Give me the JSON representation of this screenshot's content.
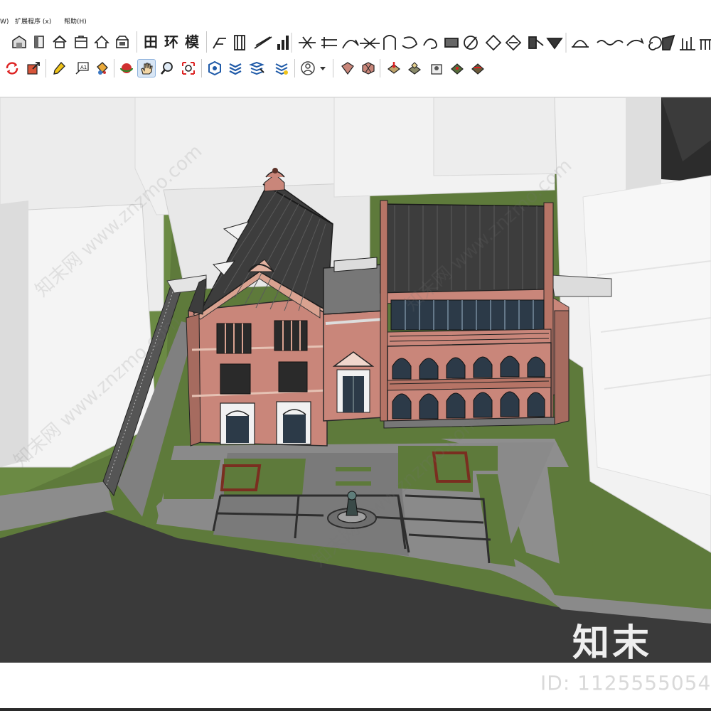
{
  "menu": {
    "items": [
      {
        "label": "W)"
      },
      {
        "label": "扩展程序 (x)"
      },
      {
        "label": "帮助(H)"
      }
    ]
  },
  "toolbar1": {
    "buttons": [
      {
        "name": "warehouse-icon"
      },
      {
        "name": "component-box-icon"
      },
      {
        "name": "house-icon"
      },
      {
        "name": "house-outline-icon"
      },
      {
        "name": "house-roof-icon"
      },
      {
        "name": "house-window-icon"
      },
      {
        "name": "grid-plan-icon",
        "glyph": "田"
      },
      {
        "name": "environment-icon",
        "glyph": "环"
      },
      {
        "name": "model-icon",
        "glyph": "模"
      }
    ]
  },
  "toolbar2": {
    "buttons": [
      {
        "name": "orbit-icon"
      },
      {
        "name": "scale-icon"
      },
      {
        "name": "paint-icon"
      },
      {
        "name": "text-tool-icon"
      },
      {
        "name": "paint-bucket-icon"
      },
      {
        "name": "orbit-sphere-icon"
      },
      {
        "name": "pan-hand-icon",
        "active": true
      },
      {
        "name": "zoom-icon"
      },
      {
        "name": "zoom-extents-icon"
      },
      {
        "name": "shapes-icon"
      },
      {
        "name": "layers-icon"
      },
      {
        "name": "stack-icon"
      },
      {
        "name": "sandbox-icon"
      },
      {
        "name": "user-account-icon"
      },
      {
        "name": "components-icon"
      },
      {
        "name": "terrain-grid-icon"
      },
      {
        "name": "geo-location-icon"
      },
      {
        "name": "photo-texture-icon"
      },
      {
        "name": "add-location-icon"
      },
      {
        "name": "preview-terrain-icon"
      },
      {
        "name": "toggle-terrain-icon"
      }
    ]
  },
  "watermark": {
    "brand": "知末",
    "id_text": "ID: 1125555054",
    "diagonal_text": "知末网 www.znzmo.com"
  },
  "colors": {
    "brick": "#c9867a",
    "roof": "#3d3d3d",
    "grass": "#5e7a3b",
    "road": "#3a3a3a",
    "paving": "#8a8a8a",
    "glass": "#2c3a48",
    "massing": "#eeeeee"
  }
}
